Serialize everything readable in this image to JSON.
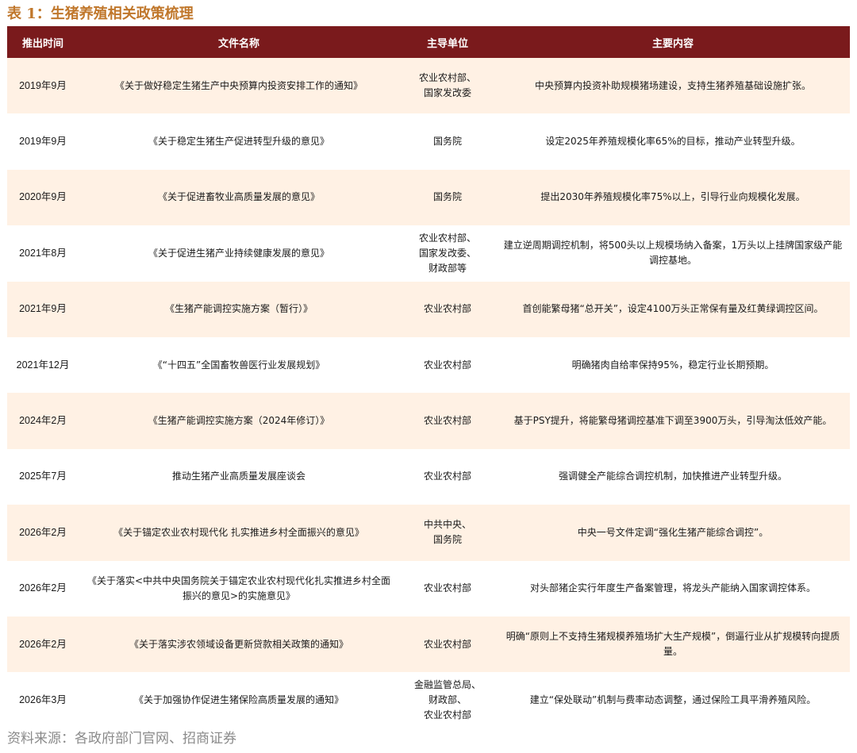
{
  "caption": "表 1：生猪养殖相关政策梳理",
  "headers": {
    "time": "推出时间",
    "document": "文件名称",
    "unit": "主导单位",
    "content": "主要内容"
  },
  "rows": [
    {
      "time": "2019年9月",
      "document": "《关于做好稳定生猪生产中央预算内投资安排工作的通知》",
      "unit": "农业农村部、\n国家发改委",
      "content": "中央预算内投资补助规模猪场建设，支持生猪养殖基础设施扩张。"
    },
    {
      "time": "2019年9月",
      "document": "《关于稳定生猪生产促进转型升级的意见》",
      "unit": "国务院",
      "content": "设定2025年养殖规模化率65%的目标，推动产业转型升级。"
    },
    {
      "time": "2020年9月",
      "document": "《关于促进畜牧业高质量发展的意见》",
      "unit": "国务院",
      "content": "提出2030年养殖规模化率75%以上，引导行业向规模化发展。"
    },
    {
      "time": "2021年8月",
      "document": "《关于促进生猪产业持续健康发展的意见》",
      "unit": "农业农村部、\n国家发改委、\n财政部等",
      "content": "建立逆周期调控机制，将500头以上规模场纳入备案，1万头以上挂牌国家级产能调控基地。"
    },
    {
      "time": "2021年9月",
      "document": "《生猪产能调控实施方案（暂行）》",
      "unit": "农业农村部",
      "content": "首创能繁母猪“总开关”，设定4100万头正常保有量及红黄绿调控区间。"
    },
    {
      "time": "2021年12月",
      "document": "《“十四五”全国畜牧兽医行业发展规划》",
      "unit": "农业农村部",
      "content": "明确猪肉自给率保持95%，稳定行业长期预期。"
    },
    {
      "time": "2024年2月",
      "document": "《生猪产能调控实施方案（2024年修订）》",
      "unit": "农业农村部",
      "content": "基于PSY提升，将能繁母猪调控基准下调至3900万头，引导淘汰低效产能。"
    },
    {
      "time": "2025年7月",
      "document": "推动生猪产业高质量发展座谈会",
      "unit": "农业农村部",
      "content": "强调健全产能综合调控机制，加快推进产业转型升级。"
    },
    {
      "time": "2026年2月",
      "document": "《关于锚定农业农村现代化 扎实推进乡村全面振兴的意见》",
      "unit": "中共中央、\n国务院",
      "content": "中央一号文件定调“强化生猪产能综合调控”。"
    },
    {
      "time": "2026年2月",
      "document": "《关于落实<中共中央国务院关于锚定农业农村现代化扎实推进乡村全面振兴的意见>的实施意见》",
      "unit": "农业农村部",
      "content": "对头部猪企实行年度生产备案管理，将龙头产能纳入国家调控体系。"
    },
    {
      "time": "2026年2月",
      "document": "《关于落实涉农领域设备更新贷款相关政策的通知》",
      "unit": "农业农村部",
      "content": "明确“原则上不支持生猪规模养殖场扩大生产规模”，倒逼行业从扩规模转向提质量。"
    },
    {
      "time": "2026年3月",
      "document": "《关于加强协作促进生猪保险高质量发展的通知》",
      "unit": "金融监管总局、\n财政部、\n农业农村部",
      "content": "建立“保处联动”机制与费率动态调整，通过保险工具平滑养殖风险。"
    }
  ],
  "source": "资料来源：各政府部门官网、招商证券"
}
